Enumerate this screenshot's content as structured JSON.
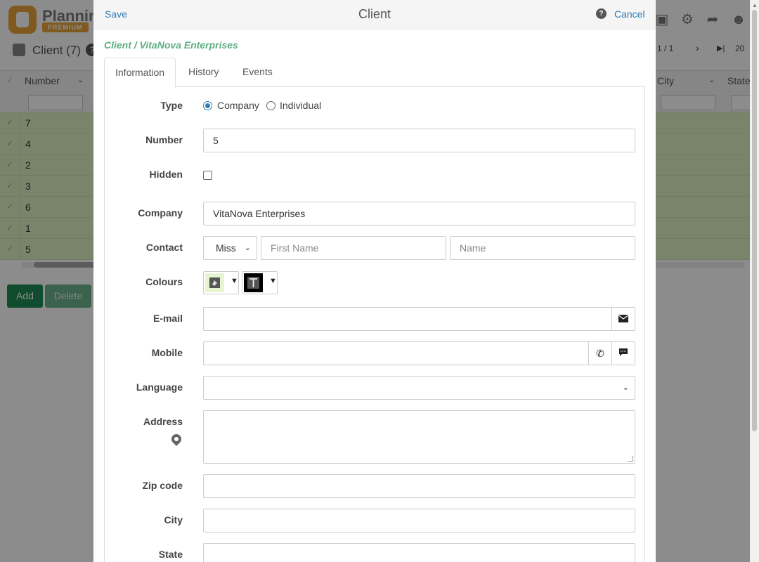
{
  "app": {
    "logo_text": "Planning",
    "logo_badge": "PREMIUM",
    "page_title": "Client (7)",
    "help_glyph": "?",
    "pager_text": "1 / 1",
    "page_size": "20",
    "header_icons": [
      "database-icon",
      "gear-icon",
      "share-icon",
      "user-icon"
    ]
  },
  "grid": {
    "columns": {
      "number": "Number",
      "city": "City",
      "state": "State"
    },
    "rows": [
      "7",
      "4",
      "2",
      "3",
      "6",
      "1",
      "5"
    ],
    "add_label": "Add",
    "delete_label": "Delete"
  },
  "dialog": {
    "save_label": "Save",
    "title": "Client",
    "help_glyph": "?",
    "cancel_label": "Cancel",
    "breadcrumb": "Client / VitaNova Enterprises",
    "tabs": [
      {
        "label": "Information",
        "active": true
      },
      {
        "label": "History",
        "active": false
      },
      {
        "label": "Events",
        "active": false
      }
    ],
    "form": {
      "type": {
        "label": "Type",
        "options": [
          "Company",
          "Individual"
        ],
        "selected": "Company"
      },
      "number": {
        "label": "Number",
        "value": "5"
      },
      "hidden": {
        "label": "Hidden",
        "checked": false
      },
      "company": {
        "label": "Company",
        "value": "VitaNova Enterprises"
      },
      "contact": {
        "label": "Contact",
        "title_value": "Miss",
        "first_name_placeholder": "First Name",
        "name_placeholder": "Name"
      },
      "colours": {
        "label": "Colours",
        "background_color": "#e6f5d0",
        "text_color": "#000000"
      },
      "email": {
        "label": "E-mail",
        "value": ""
      },
      "mobile": {
        "label": "Mobile",
        "value": ""
      },
      "language": {
        "label": "Language",
        "value": ""
      },
      "address": {
        "label": "Address",
        "value": ""
      },
      "zip": {
        "label": "Zip code",
        "value": ""
      },
      "city": {
        "label": "City",
        "value": ""
      },
      "state": {
        "label": "State",
        "value": ""
      }
    }
  },
  "colors": {
    "accent_link": "#2f7fb8",
    "breadcrumb_green": "#5fae83",
    "row_highlight": "#dff0c4",
    "add_button": "#1e8a55",
    "delete_button": "#6ab28b"
  }
}
